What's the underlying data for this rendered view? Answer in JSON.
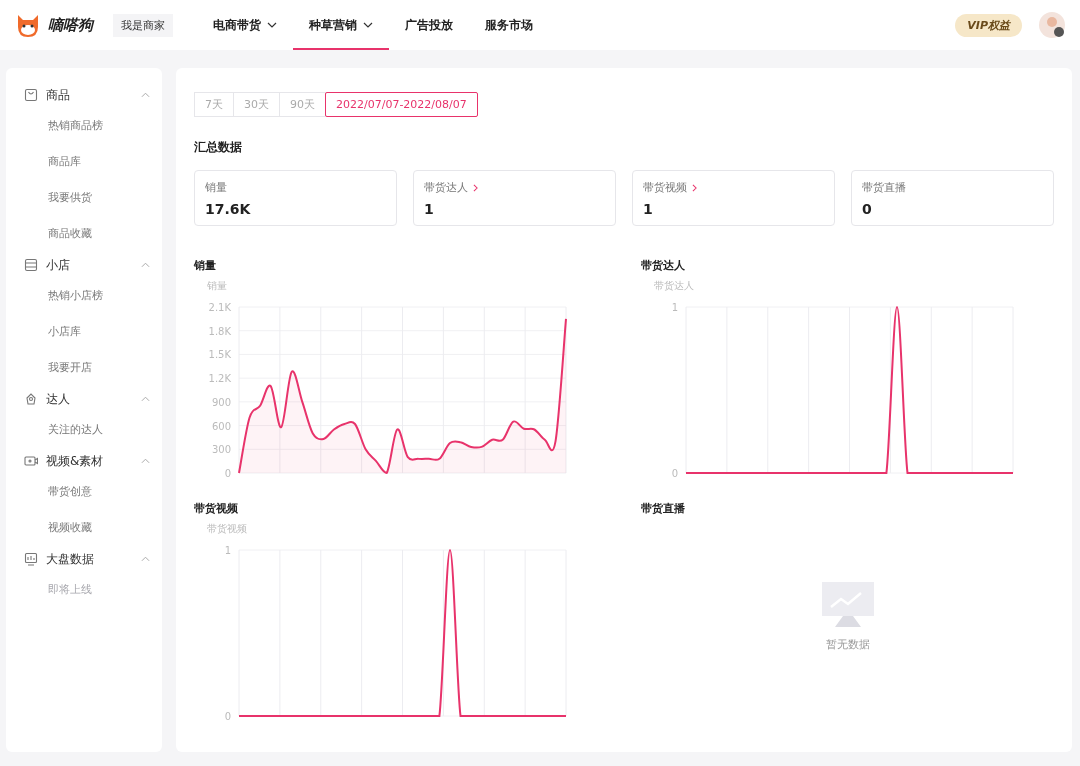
{
  "header": {
    "brand": "嘀嗒狗",
    "role_switch": "我是商家",
    "nav": [
      {
        "label": "电商带货",
        "dropdown": true,
        "selected": false
      },
      {
        "label": "种草营销",
        "dropdown": true,
        "selected": true
      },
      {
        "label": "广告投放",
        "dropdown": false,
        "selected": false
      },
      {
        "label": "服务市场",
        "dropdown": false,
        "selected": false
      }
    ],
    "vip_badge": "VIP权益"
  },
  "sidebar": {
    "groups": [
      {
        "label": "商品",
        "expanded": true,
        "items": [
          {
            "label": "热销商品榜",
            "selected": false,
            "disabled": false
          },
          {
            "label": "商品库",
            "selected": false,
            "disabled": false
          },
          {
            "label": "我要供货",
            "selected": false,
            "disabled": false
          },
          {
            "label": "商品收藏",
            "selected": false,
            "disabled": false
          }
        ]
      },
      {
        "label": "小店",
        "expanded": true,
        "items": [
          {
            "label": "热销小店榜",
            "selected": false,
            "disabled": false
          },
          {
            "label": "小店库",
            "selected": false,
            "disabled": false
          },
          {
            "label": "我要开店",
            "selected": false,
            "disabled": false
          }
        ]
      },
      {
        "label": "达人",
        "expanded": true,
        "items": [
          {
            "label": "关注的达人",
            "selected": false,
            "disabled": false
          }
        ]
      },
      {
        "label": "视频&素材",
        "expanded": true,
        "items": [
          {
            "label": "带货创意",
            "selected": false,
            "disabled": false
          },
          {
            "label": "视频收藏",
            "selected": false,
            "disabled": false
          }
        ]
      },
      {
        "label": "大盘数据",
        "expanded": true,
        "items": [
          {
            "label": "即将上线",
            "selected": false,
            "disabled": true
          }
        ]
      }
    ]
  },
  "date_tabs": [
    {
      "label": "7天",
      "selected": false
    },
    {
      "label": "30天",
      "selected": false
    },
    {
      "label": "90天",
      "selected": false
    },
    {
      "label": "2022/07/07-2022/08/07",
      "selected": true
    }
  ],
  "summary": {
    "title": "汇总数据",
    "cards": [
      {
        "label": "销量",
        "value": "17.6K",
        "link": false
      },
      {
        "label": "带货达人",
        "value": "1",
        "link": true
      },
      {
        "label": "带货视频",
        "value": "1",
        "link": true
      },
      {
        "label": "带货直播",
        "value": "0",
        "link": false
      }
    ]
  },
  "charts": [
    {
      "title": "销量",
      "chart_data": {
        "type": "area",
        "grid": true,
        "ylabel": "销量",
        "ylim": [
          0,
          2100
        ],
        "yticks": [
          0,
          300,
          600,
          900,
          {
            "value": 1200,
            "label": "1.2K"
          },
          {
            "value": 1500,
            "label": "1.5K"
          },
          {
            "value": 1800,
            "label": "1.8K"
          },
          {
            "value": 2100,
            "label": "2.1K"
          }
        ],
        "series": [
          {
            "color": "#e8336b",
            "values": [
              0,
              700,
              850,
              1100,
              580,
              1280,
              900,
              500,
              430,
              550,
              620,
              620,
              300,
              150,
              0,
              550,
              200,
              180,
              180,
              180,
              380,
              390,
              330,
              330,
              420,
              420,
              650,
              560,
              550,
              420,
              400,
              1950
            ]
          }
        ]
      }
    },
    {
      "title": "带货达人",
      "chart_data": {
        "type": "line",
        "grid": true,
        "ylabel": "带货达人",
        "ylim": [
          0,
          1
        ],
        "yticks": [
          0,
          1
        ],
        "series": [
          {
            "color": "#e8336b",
            "values": [
              0,
              0,
              0,
              0,
              0,
              0,
              0,
              0,
              0,
              0,
              0,
              0,
              0,
              0,
              0,
              0,
              0,
              0,
              0,
              0,
              1,
              0,
              0,
              0,
              0,
              0,
              0,
              0,
              0,
              0,
              0,
              0
            ]
          }
        ]
      }
    },
    {
      "title": "带货视频",
      "chart_data": {
        "type": "line",
        "grid": true,
        "ylabel": "带货视频",
        "ylim": [
          0,
          1
        ],
        "yticks": [
          0,
          1
        ],
        "series": [
          {
            "color": "#e8336b",
            "values": [
              0,
              0,
              0,
              0,
              0,
              0,
              0,
              0,
              0,
              0,
              0,
              0,
              0,
              0,
              0,
              0,
              0,
              0,
              0,
              0,
              1,
              0,
              0,
              0,
              0,
              0,
              0,
              0,
              0,
              0,
              0,
              0
            ]
          }
        ]
      }
    },
    {
      "title": "带货直播",
      "empty_text": "暂无数据"
    }
  ]
}
